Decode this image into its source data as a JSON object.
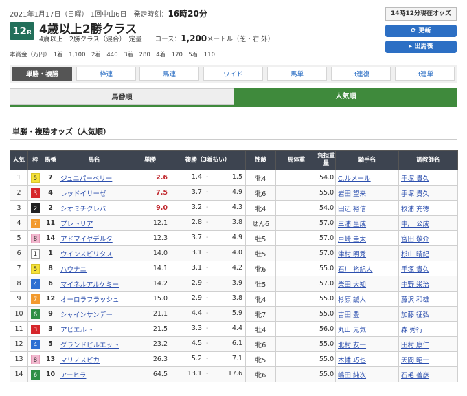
{
  "header": {
    "date_line": "2021年1月17日（日曜） 1回中山6日　発走時刻：",
    "post_time": "16時20分",
    "race_number": "12",
    "race_number_suffix": "R",
    "race_name": "4歳以上2勝クラス",
    "sub_line": "4歳以上　2勝クラス（混合）　定量　　コース：",
    "distance": "1,200",
    "course_suffix": "メートル（芝・右 外）",
    "prize_line": "本賞金（万円）　1着　1,100　2着　440　3着　280　4着　170　5着　110"
  },
  "side": {
    "time_status": "14時12分現在オッズ",
    "refresh_button": "⟳ 更新",
    "entries_button": "▸ 出馬表"
  },
  "tabs": [
    {
      "label": "単勝・複勝",
      "active": true
    },
    {
      "label": "枠連",
      "active": false
    },
    {
      "label": "馬連",
      "active": false
    },
    {
      "label": "ワイド",
      "active": false
    },
    {
      "label": "馬単",
      "active": false
    },
    {
      "label": "3連複",
      "active": false
    },
    {
      "label": "3連単",
      "active": false
    }
  ],
  "sort": {
    "by_number": "馬番順",
    "by_popularity": "人気順"
  },
  "section_title": "単勝・複勝オッズ（人気順）",
  "table": {
    "headers": [
      "人気",
      "枠",
      "馬番",
      "馬名",
      "単勝",
      "複勝（3着払い）",
      "性齢",
      "馬体重",
      "負担重量",
      "騎手名",
      "調教師名"
    ],
    "rows": [
      {
        "pop": "1",
        "waku": "5",
        "num": "7",
        "name": "ジュニパーベリー",
        "win": "2.6",
        "place_lo": "1.4",
        "place_hi": "1.5",
        "sex_age": "牝4",
        "weight": "",
        "burden": "54.0",
        "jockey": "C.ルメール",
        "trainer": "手塚 貴久"
      },
      {
        "pop": "2",
        "waku": "3",
        "num": "4",
        "name": "レッドイリーゼ",
        "win": "7.5",
        "place_lo": "3.7",
        "place_hi": "4.9",
        "sex_age": "牝6",
        "weight": "",
        "burden": "55.0",
        "jockey": "岩田 望来",
        "trainer": "手塚 貴久"
      },
      {
        "pop": "3",
        "waku": "2",
        "num": "2",
        "name": "シオミチクレバ",
        "win": "9.0",
        "place_lo": "3.2",
        "place_hi": "4.3",
        "sex_age": "牝4",
        "weight": "",
        "burden": "54.0",
        "jockey": "田辺 裕信",
        "trainer": "牧浦 充徳"
      },
      {
        "pop": "4",
        "waku": "7",
        "num": "11",
        "name": "プレトリア",
        "win": "12.1",
        "place_lo": "2.8",
        "place_hi": "3.8",
        "sex_age": "せん6",
        "weight": "",
        "burden": "57.0",
        "jockey": "三浦 皇成",
        "trainer": "中川 公成"
      },
      {
        "pop": "5",
        "waku": "8",
        "num": "14",
        "name": "アドマイヤデルタ",
        "win": "12.3",
        "place_lo": "3.7",
        "place_hi": "4.9",
        "sex_age": "牡5",
        "weight": "",
        "burden": "57.0",
        "jockey": "戸崎 圭太",
        "trainer": "宮田 敬介"
      },
      {
        "pop": "6",
        "waku": "1",
        "num": "1",
        "name": "ウインスピリタス",
        "win": "14.0",
        "place_lo": "3.1",
        "place_hi": "4.0",
        "sex_age": "牡5",
        "weight": "",
        "burden": "57.0",
        "jockey": "津村 明秀",
        "trainer": "杉山 晴紀"
      },
      {
        "pop": "7",
        "waku": "5",
        "num": "8",
        "name": "ハウナニ",
        "win": "14.1",
        "place_lo": "3.1",
        "place_hi": "4.2",
        "sex_age": "牝6",
        "weight": "",
        "burden": "55.0",
        "jockey": "石川 裕紀人",
        "trainer": "手塚 貴久"
      },
      {
        "pop": "8",
        "waku": "4",
        "num": "6",
        "name": "マイネルアルケミー",
        "win": "14.2",
        "place_lo": "2.9",
        "place_hi": "3.9",
        "sex_age": "牡5",
        "weight": "",
        "burden": "57.0",
        "jockey": "柴田 大知",
        "trainer": "中野 栄治"
      },
      {
        "pop": "9",
        "waku": "7",
        "num": "12",
        "name": "オーロラフラッシュ",
        "win": "15.0",
        "place_lo": "2.9",
        "place_hi": "3.8",
        "sex_age": "牝4",
        "weight": "",
        "burden": "55.0",
        "jockey": "杉原 誠人",
        "trainer": "藤沢 和雄"
      },
      {
        "pop": "10",
        "waku": "6",
        "num": "9",
        "name": "シャインサンデー",
        "win": "21.1",
        "place_lo": "4.4",
        "place_hi": "5.9",
        "sex_age": "牝7",
        "weight": "",
        "burden": "55.0",
        "jockey": "吉田 豊",
        "trainer": "加藤 征弘"
      },
      {
        "pop": "11",
        "waku": "3",
        "num": "3",
        "name": "アビエルト",
        "win": "21.5",
        "place_lo": "3.3",
        "place_hi": "4.4",
        "sex_age": "牡4",
        "weight": "",
        "burden": "56.0",
        "jockey": "丸山 元気",
        "trainer": "森 秀行"
      },
      {
        "pop": "12",
        "waku": "4",
        "num": "5",
        "name": "グランドピルエット",
        "win": "23.2",
        "place_lo": "4.5",
        "place_hi": "6.1",
        "sex_age": "牝6",
        "weight": "",
        "burden": "55.0",
        "jockey": "北村 友一",
        "trainer": "田村 康仁"
      },
      {
        "pop": "13",
        "waku": "8",
        "num": "13",
        "name": "マリノスピカ",
        "win": "26.3",
        "place_lo": "5.2",
        "place_hi": "7.1",
        "sex_age": "牝5",
        "weight": "",
        "burden": "55.0",
        "jockey": "木幡 巧也",
        "trainer": "天間 昭一"
      },
      {
        "pop": "14",
        "waku": "6",
        "num": "10",
        "name": "アーヒラ",
        "win": "64.5",
        "place_lo": "13.1",
        "place_hi": "17.6",
        "sex_age": "牝6",
        "weight": "",
        "burden": "55.0",
        "jockey": "嶋田 純次",
        "trainer": "石毛 善彦"
      }
    ]
  },
  "colors": {
    "race_badge": "#226f5a",
    "popular_tab": "#3f8a3c",
    "button_blue": "#2c6fc4",
    "win_highlight": "#c0272d",
    "waku": {
      "1": {
        "bg": "#ffffff",
        "fg": "#333333",
        "border": "#999999"
      },
      "2": {
        "bg": "#222222",
        "fg": "#ffffff",
        "border": "#222222"
      },
      "3": {
        "bg": "#d6262b",
        "fg": "#ffffff",
        "border": "#d6262b"
      },
      "4": {
        "bg": "#2c6fd2",
        "fg": "#ffffff",
        "border": "#2c6fd2"
      },
      "5": {
        "bg": "#f5e23a",
        "fg": "#333333",
        "border": "#d9c52a"
      },
      "6": {
        "bg": "#2f8f45",
        "fg": "#ffffff",
        "border": "#2f8f45"
      },
      "7": {
        "bg": "#f29a2e",
        "fg": "#ffffff",
        "border": "#f29a2e"
      },
      "8": {
        "bg": "#f2b8cf",
        "fg": "#333333",
        "border": "#e59ab6"
      }
    }
  }
}
